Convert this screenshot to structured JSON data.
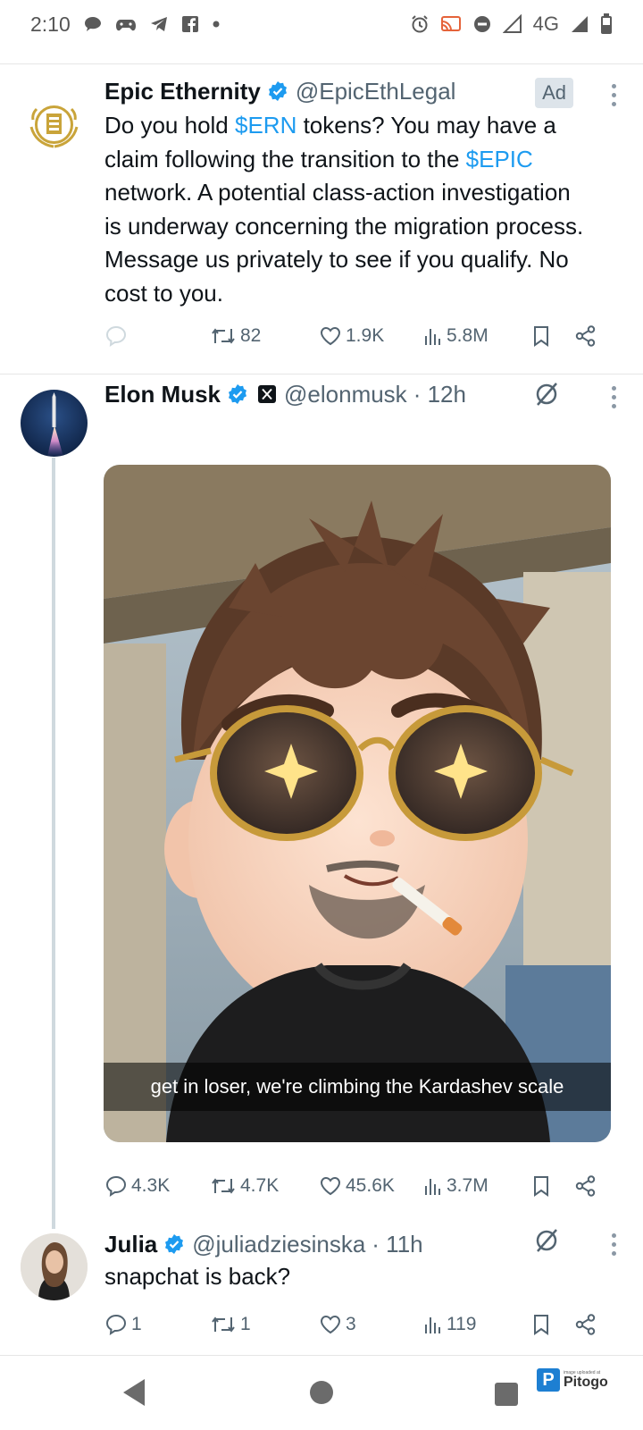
{
  "status_bar": {
    "time": "2:10",
    "network": "4G",
    "left_icons": [
      "chat-bubble-icon",
      "game-controller-icon",
      "telegram-icon",
      "facebook-icon",
      "dot-icon"
    ],
    "right_icons": [
      "alarm-icon",
      "cast-icon",
      "do-not-disturb-icon",
      "signal-icon",
      "battery-icon"
    ]
  },
  "tweets": [
    {
      "name": "Epic Ethernity",
      "handle": "@EpicEthLegal",
      "ad_label": "Ad",
      "text_parts": [
        "Do you hold ",
        "$ERN",
        " tokens? You may have a claim following the transition to the ",
        "$EPIC",
        " network. A potential class-action investigation is underway concerning the migration process. Message us privately to see if you qualify. No cost to you."
      ],
      "actions": {
        "replies": "",
        "reposts": "82",
        "likes": "1.9K",
        "views": "5.8M"
      }
    },
    {
      "name": "Elon Musk",
      "handle": "@elonmusk",
      "time": "· 12h",
      "media_caption": "get in loser, we're climbing the Kardashev scale",
      "actions": {
        "replies": "4.3K",
        "reposts": "4.7K",
        "likes": "45.6K",
        "views": "3.7M"
      }
    },
    {
      "name": "Julia",
      "handle": "@juliadziesinska",
      "time": "· 11h",
      "text": "snapchat is back?",
      "actions": {
        "replies": "1",
        "reposts": "1",
        "likes": "3",
        "views": "119"
      }
    }
  ],
  "watermark": {
    "small_text": "image uploaded at",
    "name": "Pitogo",
    "letter": "P"
  },
  "colors": {
    "link": "#1d9bf0",
    "verified": "#1d9bf0",
    "muted": "#536471"
  }
}
